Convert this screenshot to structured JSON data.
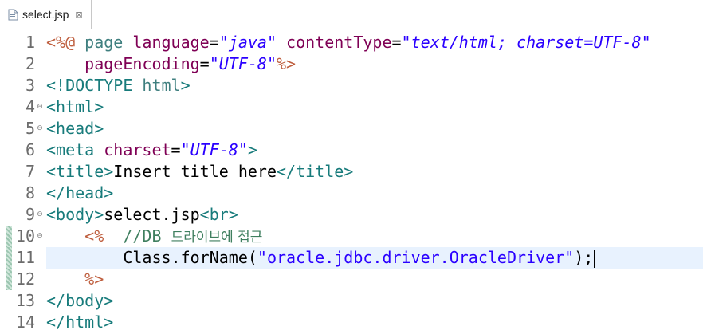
{
  "tab": {
    "filename": "select.jsp",
    "close_glyph": "⊠"
  },
  "lines": {
    "l1": {
      "num": "1",
      "a": "<%@",
      "b": " page ",
      "c": "language",
      "d": "=",
      "e": "\"java\"",
      "f": " contentType",
      "g": "=",
      "h": "\"text/html; charset=UTF-8\""
    },
    "l2": {
      "num": "2",
      "indent": "    ",
      "a": "pageEncoding",
      "b": "=",
      "c": "\"UTF-8\"",
      "d": "%>"
    },
    "l3": {
      "num": "3",
      "a": "<!DOCTYPE",
      "b": " html",
      "c": ">"
    },
    "l4": {
      "num": "4",
      "a": "<html>"
    },
    "l5": {
      "num": "5",
      "a": "<head>"
    },
    "l6": {
      "num": "6",
      "a": "<meta",
      "b": " charset",
      "c": "=",
      "d": "\"UTF-8\"",
      "e": ">"
    },
    "l7": {
      "num": "7",
      "a": "<title>",
      "b": "Insert title here",
      "c": "</title>"
    },
    "l8": {
      "num": "8",
      "a": "</head>"
    },
    "l9": {
      "num": "9",
      "a": "<body>",
      "b": "select.jsp",
      "c": "<br>"
    },
    "l10": {
      "num": "10",
      "indent": "    ",
      "a": "<%",
      "b": "  //DB ",
      "c": "드라이브에 접근"
    },
    "l11": {
      "num": "11",
      "indent": "        ",
      "a": "Class.forName(",
      "b": "\"oracle.jdbc.driver.OracleDriver\"",
      "c": ");"
    },
    "l12": {
      "num": "12",
      "indent": "    ",
      "a": "%>"
    },
    "l13": {
      "num": "13",
      "a": "</body>"
    },
    "l14": {
      "num": "14",
      "a": "</html>"
    }
  },
  "colors": {
    "tag": "#177b7b",
    "attribute": "#7f0055",
    "value": "#2a00ff",
    "jsp_delimiter": "#bf5f3f",
    "comment": "#3f7f5f",
    "current_line": "#e8f2fe"
  },
  "icons": {
    "tab": "jsp-file-icon",
    "fold": "fold-minus-icon",
    "close": "close-tab-icon"
  }
}
